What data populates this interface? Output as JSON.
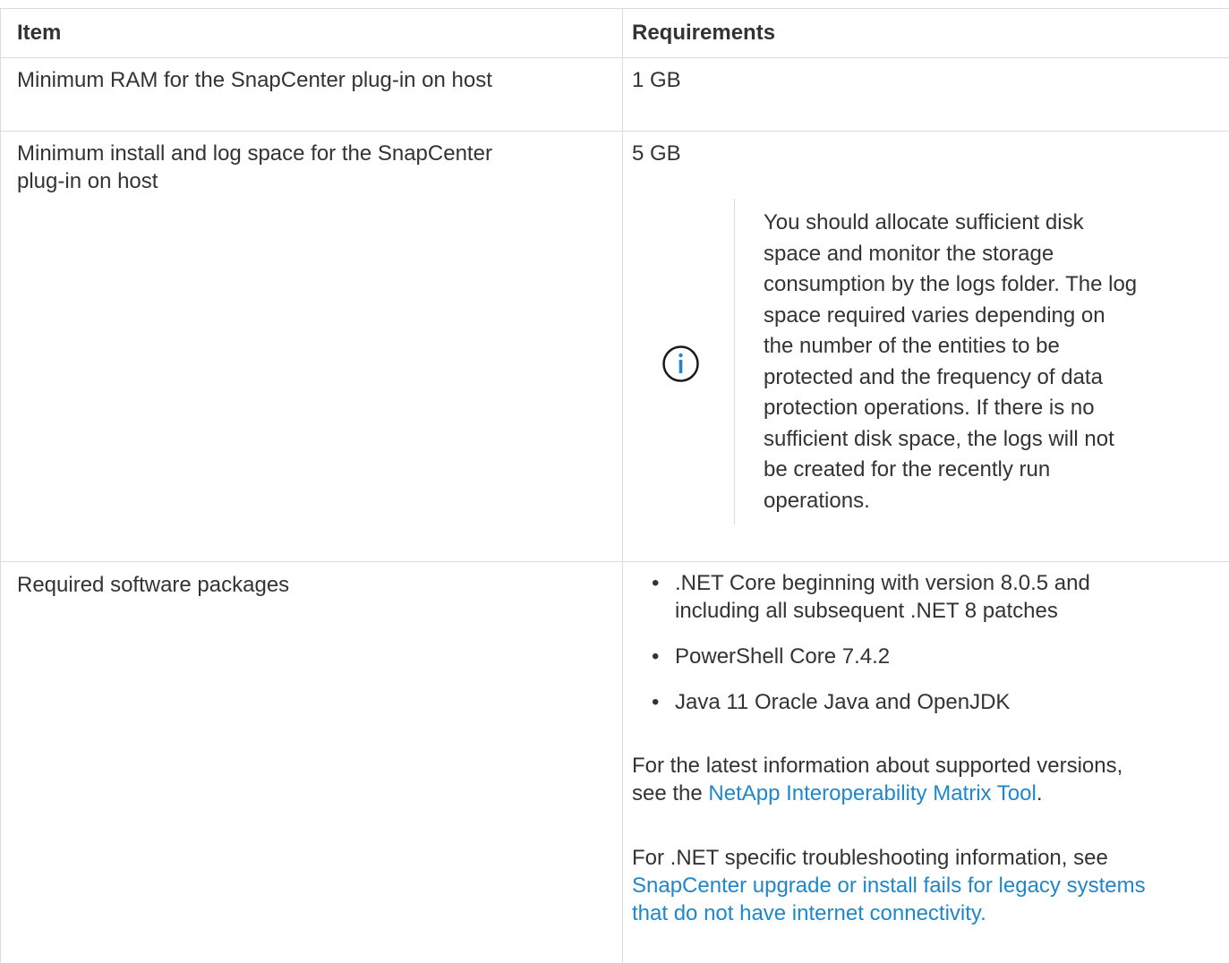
{
  "table": {
    "headers": {
      "item": "Item",
      "requirements": "Requirements"
    },
    "rows": [
      {
        "item": "Minimum RAM for the SnapCenter plug-in on host",
        "requirement": "1 GB"
      },
      {
        "item_line1": "Minimum install and log space for the SnapCenter",
        "item_line2": "plug-in on host",
        "requirement": "5 GB",
        "note": {
          "icon": "info-icon",
          "lines": [
            "You should allocate sufficient disk",
            "space and monitor the storage",
            "consumption by the logs folder. The log",
            "space required varies depending on",
            "the number of the entities to be",
            "protected and the frequency of data",
            "protection operations. If there is no",
            "sufficient disk space, the logs will not",
            "be created for the recently run",
            "operations."
          ]
        }
      },
      {
        "item": "Required software packages",
        "packages": [
          {
            "line1": ".NET Core beginning with version 8.0.5 and",
            "line2": "including all subsequent .NET 8 patches"
          },
          {
            "line1": "PowerShell Core 7.4.2"
          },
          {
            "line1": "Java 11 Oracle Java and OpenJDK"
          }
        ],
        "bullet": "•",
        "para1": {
          "line1": "For the latest information about supported versions,",
          "prefix": "see the ",
          "link": "NetApp Interoperability Matrix Tool",
          "suffix": "."
        },
        "para2": {
          "line1": "For .NET specific troubleshooting information, see",
          "link_line1": "SnapCenter upgrade or install fails for legacy systems",
          "link_line2": "that do not have internet connectivity."
        }
      }
    ],
    "colors": {
      "text": "#333333",
      "link": "#1f87c9",
      "border": "#dcdcdc",
      "icon": "#1a1a1a",
      "icon_accent": "#1f87c9"
    }
  }
}
